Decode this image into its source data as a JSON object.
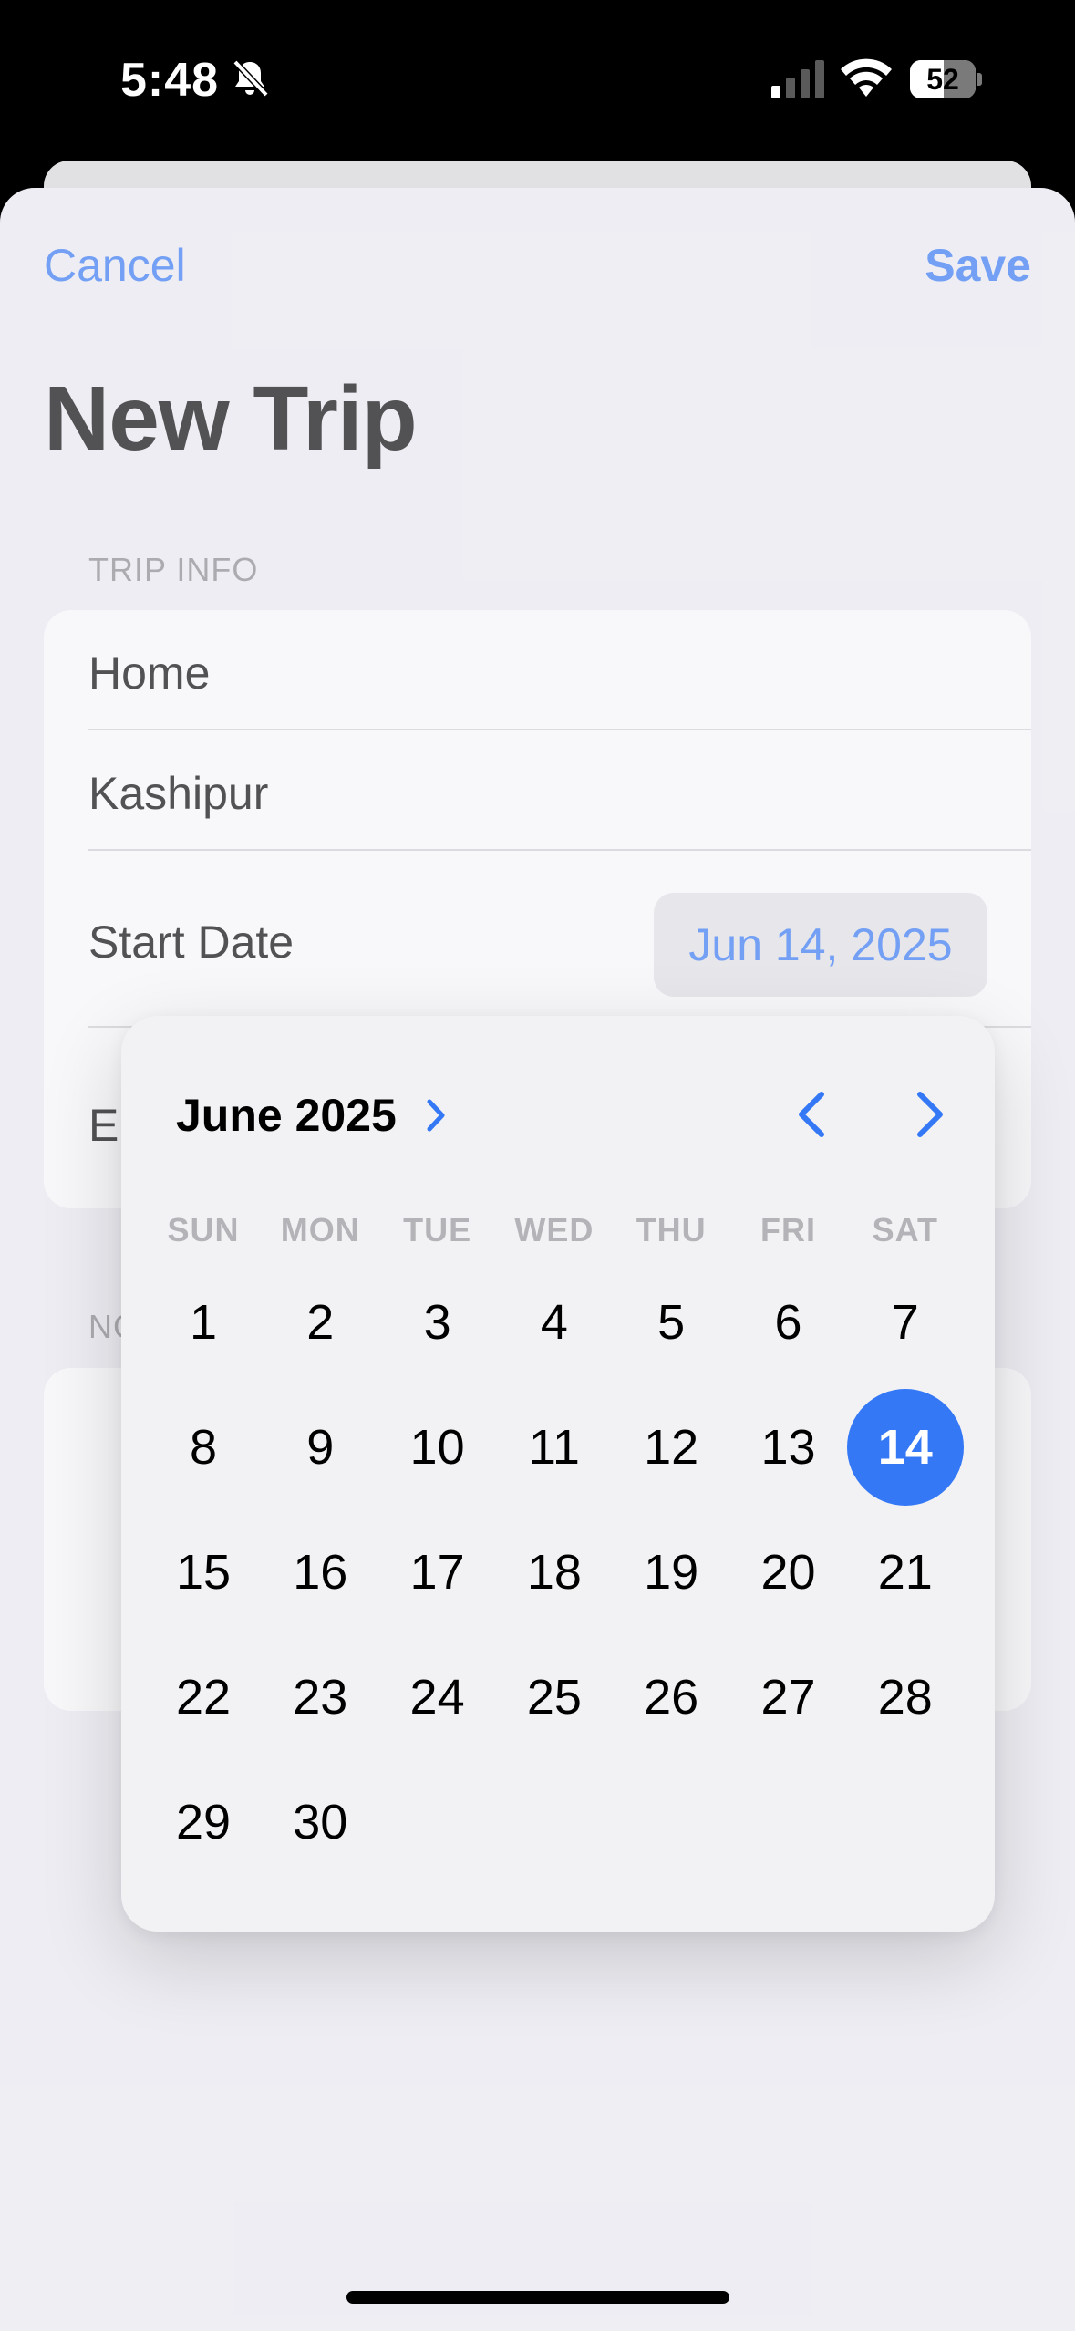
{
  "status_bar": {
    "time": "5:48",
    "battery": "52",
    "battery_level": 0.52,
    "icons": [
      "bell-slash-icon",
      "cellular-signal-icon",
      "wifi-icon",
      "battery-icon"
    ]
  },
  "nav": {
    "cancel_label": "Cancel",
    "save_label": "Save"
  },
  "page": {
    "title": "New Trip"
  },
  "trip_info": {
    "header": "TRIP INFO",
    "origin": "Home",
    "destination": "Kashipur",
    "start_date_label": "Start Date",
    "start_date_value": "Jun 14, 2025",
    "end_date_label_partial": "En"
  },
  "notes": {
    "header_partial": "NC"
  },
  "calendar": {
    "month_label": "June 2025",
    "weekdays": [
      "SUN",
      "MON",
      "TUE",
      "WED",
      "THU",
      "FRI",
      "SAT"
    ],
    "weeks": [
      [
        "1",
        "2",
        "3",
        "4",
        "5",
        "6",
        "7"
      ],
      [
        "8",
        "9",
        "10",
        "11",
        "12",
        "13",
        "14"
      ],
      [
        "15",
        "16",
        "17",
        "18",
        "19",
        "20",
        "21"
      ],
      [
        "22",
        "23",
        "24",
        "25",
        "26",
        "27",
        "28"
      ],
      [
        "29",
        "30",
        "",
        "",
        "",
        "",
        ""
      ]
    ],
    "selected_day": "14",
    "accent_color": "#3478f6"
  },
  "colors": {
    "accent": "#3478f6",
    "background": "#efeff4",
    "card": "#ffffff",
    "secondary_text": "#8a8a8e"
  }
}
